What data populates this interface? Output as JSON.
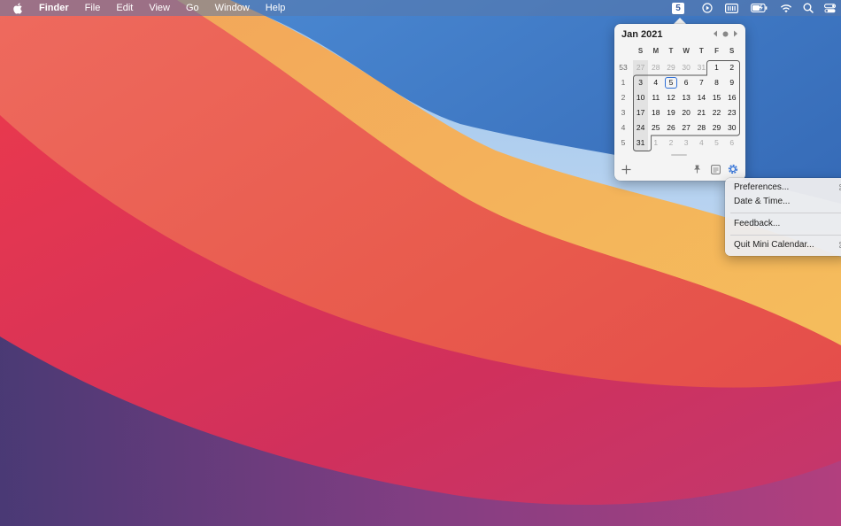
{
  "menubar": {
    "app_name": "Finder",
    "menus": [
      "File",
      "Edit",
      "View",
      "Go",
      "Window",
      "Help"
    ],
    "status": {
      "date_badge": "5",
      "icons": [
        "play-circle-icon",
        "keyboard-icon",
        "battery-charging-icon",
        "wifi-icon",
        "search-icon",
        "control-center-icon"
      ]
    }
  },
  "calendar": {
    "title": "Jan 2021",
    "weekday_headers": [
      "S",
      "M",
      "T",
      "W",
      "T",
      "F",
      "S"
    ],
    "week_numbers": [
      "53",
      "1",
      "2",
      "3",
      "4",
      "5"
    ],
    "weeks": [
      [
        {
          "d": "27",
          "o": true
        },
        {
          "d": "28",
          "o": true
        },
        {
          "d": "29",
          "o": true
        },
        {
          "d": "30",
          "o": true
        },
        {
          "d": "31",
          "o": true
        },
        {
          "d": "1"
        },
        {
          "d": "2"
        }
      ],
      [
        {
          "d": "3"
        },
        {
          "d": "4"
        },
        {
          "d": "5",
          "today": true
        },
        {
          "d": "6"
        },
        {
          "d": "7"
        },
        {
          "d": "8"
        },
        {
          "d": "9"
        }
      ],
      [
        {
          "d": "10"
        },
        {
          "d": "11"
        },
        {
          "d": "12"
        },
        {
          "d": "13"
        },
        {
          "d": "14"
        },
        {
          "d": "15"
        },
        {
          "d": "16"
        }
      ],
      [
        {
          "d": "17"
        },
        {
          "d": "18"
        },
        {
          "d": "19"
        },
        {
          "d": "20"
        },
        {
          "d": "21"
        },
        {
          "d": "22"
        },
        {
          "d": "23"
        }
      ],
      [
        {
          "d": "24"
        },
        {
          "d": "25"
        },
        {
          "d": "26"
        },
        {
          "d": "27"
        },
        {
          "d": "28"
        },
        {
          "d": "29"
        },
        {
          "d": "30"
        }
      ],
      [
        {
          "d": "31"
        },
        {
          "d": "1",
          "o": true
        },
        {
          "d": "2",
          "o": true
        },
        {
          "d": "3",
          "o": true
        },
        {
          "d": "4",
          "o": true
        },
        {
          "d": "5",
          "o": true
        },
        {
          "d": "6",
          "o": true
        }
      ]
    ],
    "accent_color": "#2f6fd6"
  },
  "context_menu": {
    "preferences": "Preferences...",
    "preferences_shortcut": "⌘,",
    "date_time": "Date & Time...",
    "feedback": "Feedback...",
    "quit": "Quit Mini Calendar...",
    "quit_shortcut": "⌘Q"
  }
}
